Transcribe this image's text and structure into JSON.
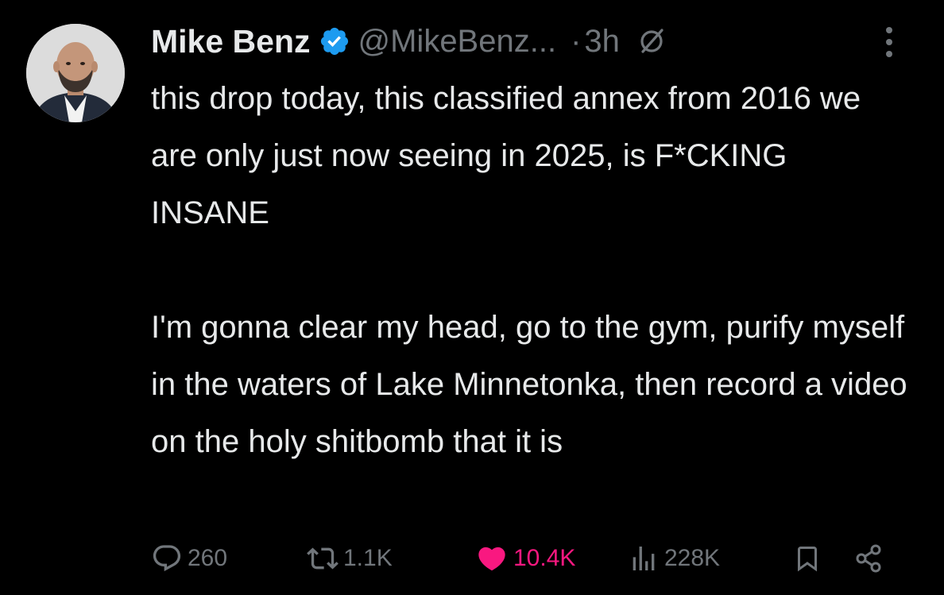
{
  "author": {
    "name": "Mike Benz",
    "handle": "@MikeBenz...",
    "separator": "·",
    "time": "3h",
    "verified_color": "#1d9bf0"
  },
  "tweet": {
    "paragraph1": "this drop today, this classified annex from 2016 we are only just now seeing in 2025, is F*CKING INSANE",
    "paragraph2": "I'm gonna clear my head, go to the gym, purify myself in the waters of Lake Minnetonka, then record a video on the holy shitbomb that it is"
  },
  "actions": {
    "replies": "260",
    "reposts": "1.1K",
    "likes": "10.4K",
    "views": "228K"
  },
  "icons": {
    "verified": "verified-badge-icon",
    "grok": "grok-icon",
    "more": "more-dots-icon",
    "reply": "reply-icon",
    "repost": "repost-icon",
    "like": "heart-icon",
    "views": "views-chart-icon",
    "bookmark": "bookmark-icon",
    "share": "share-icon"
  },
  "colors": {
    "background": "#000000",
    "text": "#e7e9ea",
    "muted": "#71767b",
    "like": "#f91880"
  }
}
